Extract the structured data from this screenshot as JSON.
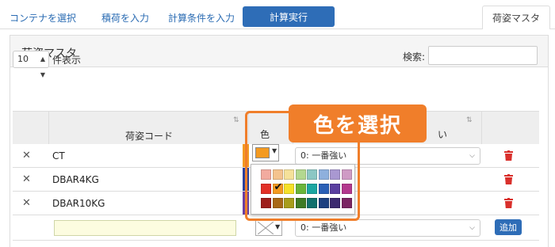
{
  "nav": {
    "links": [
      "コンテナを選択",
      "積荷を入力",
      "計算条件を入力"
    ],
    "exec_button": "計算実行",
    "active_tab": "荷姿マスタ"
  },
  "panel": {
    "title": "荷姿マスタ",
    "length_value": "10",
    "length_label": "件表示",
    "search_label": "検索:"
  },
  "table": {
    "headers": {
      "code": "荷姿コード",
      "color": "色",
      "strength": "い"
    },
    "rows": [
      {
        "code": "CT",
        "color": "#f39a21",
        "strength": "0: 一番強い"
      },
      {
        "code": "DBAR4KG",
        "color": "#2a3f9b",
        "strength": ""
      },
      {
        "code": "DBAR10KG",
        "color": "#6b3fa0",
        "strength": ""
      }
    ],
    "new_row": {
      "strength": "0: 一番強い",
      "add_label": "追加"
    }
  },
  "callout": {
    "label": "色を選択",
    "accent": "#f07e2a"
  },
  "picker": {
    "selected_color": "#f39a21",
    "palette": [
      [
        "#f2ab9f",
        "#f4c38e",
        "#f5e19a",
        "#b3d88f",
        "#8cc7c4",
        "#8eb0dd",
        "#a998d1",
        "#cf9bc5"
      ],
      [
        "#e23027",
        "#f39a21",
        "#f5e12a",
        "#6ab53a",
        "#1ba6a2",
        "#2a5fb6",
        "#5a3fa0",
        "#b3388e"
      ],
      [
        "#9e1f1b",
        "#a86817",
        "#a89d1b",
        "#3f7a25",
        "#11706d",
        "#1d4080",
        "#3c2a70",
        "#7a2562"
      ]
    ],
    "checked": [
      1,
      1
    ]
  }
}
